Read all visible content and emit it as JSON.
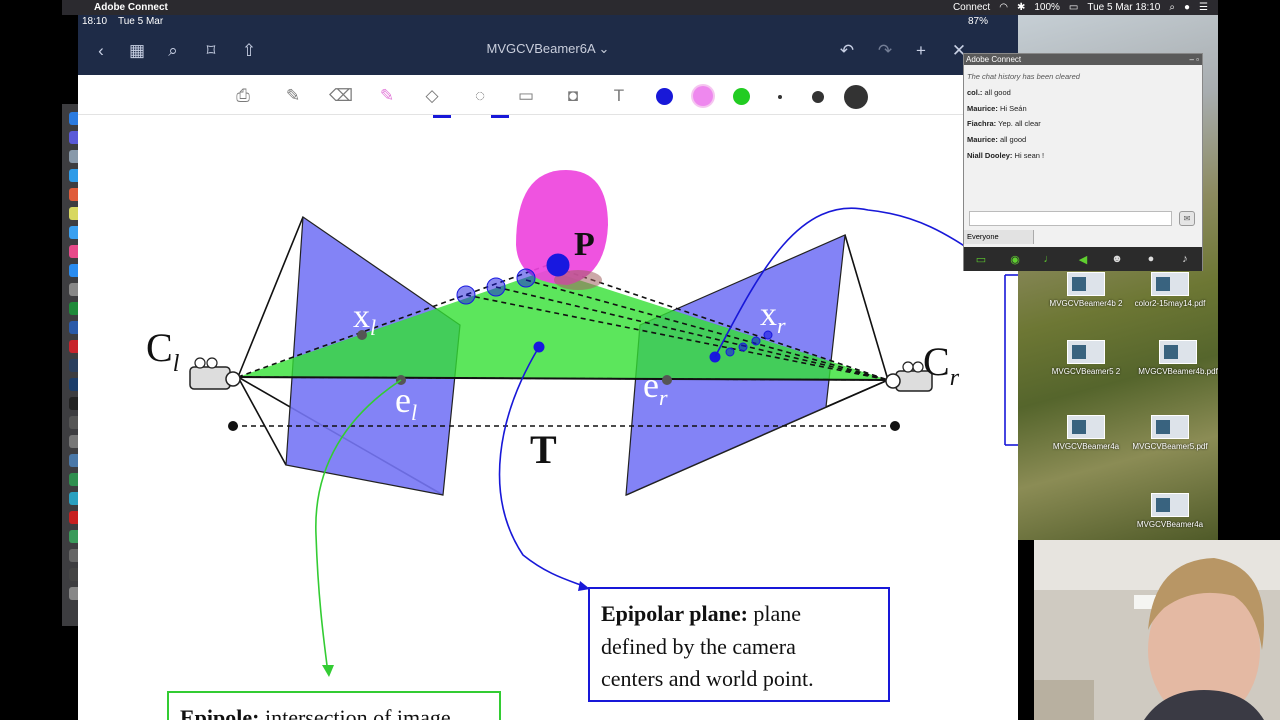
{
  "menubar": {
    "app_name": "Adobe Connect",
    "menu_connect": "Connect",
    "battery": "100%",
    "datetime": "Tue 5 Mar 18:10"
  },
  "ipad": {
    "status_time": "18:10",
    "status_date": "Tue 5 Mar",
    "status_battery": "87%",
    "document_title": "MVGCVBeamer6A",
    "pen_colors": [
      "#1818d8",
      "#ee88ee",
      "#22cc22"
    ]
  },
  "diagram": {
    "label_P": "P",
    "label_Cl_main": "C",
    "label_Cl_sub": "l",
    "label_Cr_main": "C",
    "label_Cr_sub": "r",
    "label_xl_main": "x",
    "label_xl_sub": "l",
    "label_xr_main": "x",
    "label_xr_sub": "r",
    "label_el_main": "e",
    "label_el_sub": "l",
    "label_er_main": "e",
    "label_er_sub": "r",
    "label_T": "T",
    "epipolar_plane_bold": "Epipolar plane:",
    "epipolar_plane_line1": "plane",
    "epipolar_plane_line2": "defined by the camera",
    "epipolar_plane_line3": "centers and world point.",
    "epipole_bold": "Epipole:",
    "epipole_text": "intersection of image"
  },
  "chat": {
    "window_title": "Adobe Connect",
    "cleared_notice": "The chat history has been cleared",
    "messages": [
      {
        "sender": "col.:",
        "text": "all good"
      },
      {
        "sender": "Maurice:",
        "text": "Hi Seán"
      },
      {
        "sender": "Fiachra:",
        "text": "Yep. all clear"
      },
      {
        "sender": "Maurice:",
        "text": "all good"
      },
      {
        "sender": "Niall Dooley:",
        "text": "Hi sean !"
      }
    ],
    "recipient": "Everyone",
    "input_placeholder": ""
  },
  "desktop_files": [
    "MVGCVBeamer4b 2",
    "color2-15may14.pdf",
    "MVGCVBeamer5 2",
    "MVGCVBeamer4b.pdf",
    "MVGCVBeamer4a",
    "MVGCVBeamer5.pdf",
    "MVGCVBeamer4a"
  ]
}
